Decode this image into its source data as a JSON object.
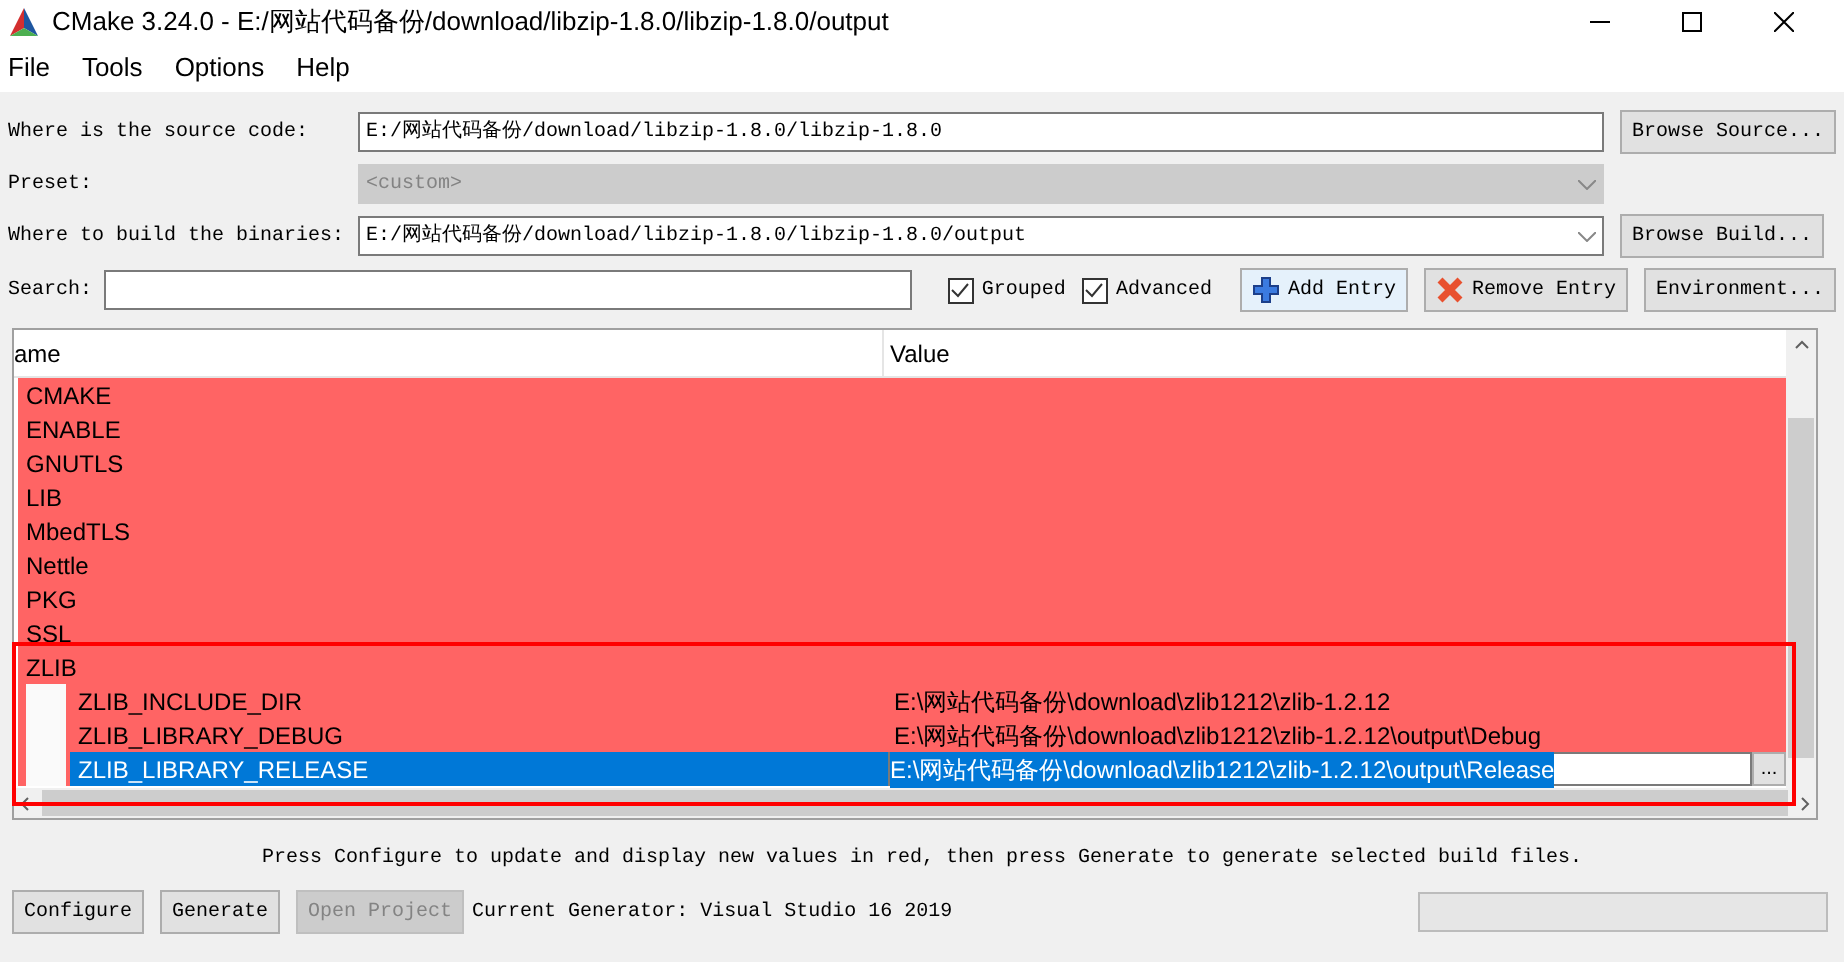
{
  "window": {
    "title": "CMake 3.24.0 - E:/网站代码备份/download/libzip-1.8.0/libzip-1.8.0/output"
  },
  "menu": [
    "File",
    "Tools",
    "Options",
    "Help"
  ],
  "source": {
    "label": "Where is the source code:",
    "value": "E:/网站代码备份/download/libzip-1.8.0/libzip-1.8.0",
    "button": "Browse Source..."
  },
  "preset": {
    "label": "Preset:",
    "value": "<custom>",
    "disabled": true
  },
  "build": {
    "label": "Where to build the binaries:",
    "value": "E:/网站代码备份/download/libzip-1.8.0/libzip-1.8.0/output",
    "button": "Browse Build..."
  },
  "search": {
    "label": "Search:"
  },
  "options": [
    {
      "label": "Grouped",
      "checked": true
    },
    {
      "label": "Advanced",
      "checked": true
    }
  ],
  "toolbar": [
    {
      "kind": "add",
      "label": "Add Entry"
    },
    {
      "kind": "remove",
      "label": "Remove Entry"
    },
    {
      "kind": "plain",
      "label": "Environment..."
    }
  ],
  "table": {
    "columns": [
      "ame",
      "Value"
    ],
    "rows": [
      {
        "name": "CMAKE"
      },
      {
        "name": "ENABLE"
      },
      {
        "name": "GNUTLS"
      },
      {
        "name": "LIB"
      },
      {
        "name": "MbedTLS"
      },
      {
        "name": "Nettle"
      },
      {
        "name": "PKG"
      },
      {
        "name": "SSL"
      },
      {
        "name": "ZLIB",
        "expanded": true,
        "children": [
          {
            "name": "ZLIB_INCLUDE_DIR",
            "value": "E:\\网站代码备份\\download\\zlib1212\\zlib-1.2.12",
            "selected": false
          },
          {
            "name": "ZLIB_LIBRARY_DEBUG",
            "value": "E:\\网站代码备份\\download\\zlib1212\\zlib-1.2.12\\output\\Debug",
            "selected": false
          },
          {
            "name": "ZLIB_LIBRARY_RELEASE",
            "value": "E:\\网站代码备份\\download\\zlib1212\\zlib-1.2.12\\output\\Release",
            "selected": true,
            "button": "..."
          }
        ]
      }
    ]
  },
  "message": "Press Configure to update and display new values in red, then press Generate to generate selected build files.",
  "buttons": [
    {
      "label": "Configure",
      "disabled": false
    },
    {
      "label": "Generate",
      "disabled": false
    },
    {
      "label": "Open Project",
      "disabled": true
    }
  ],
  "generator": "Current Generator: Visual Studio 16 2019",
  "progress": {
    "level": 0
  }
}
